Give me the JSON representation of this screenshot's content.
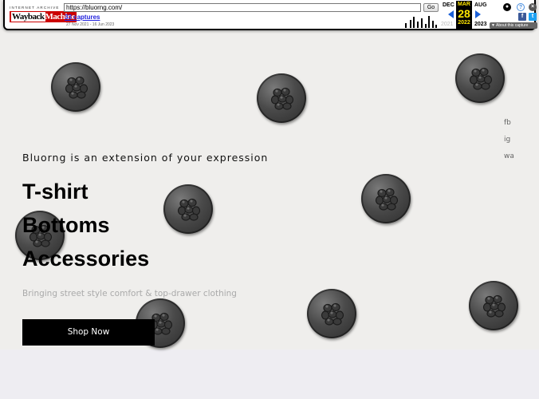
{
  "wayback": {
    "logo_top": "INTERNET ARCHIVE",
    "logo_main_a": "Wayback",
    "logo_main_b": "Machine",
    "url": "https://bluorng.com/",
    "go_label": "Go",
    "captures_label": "33 captures",
    "date_range": "27 Nov 2021 - 16 Jun 2023",
    "prev_month": "DEC",
    "current_month": "MAR",
    "current_day": "28",
    "current_year": "2022",
    "next_month": "AUG",
    "prev_year": "2021",
    "next_year": "2023",
    "about_label": "▼ About this capture",
    "help_glyph": "?",
    "close_glyph": "×",
    "fb_glyph": "f",
    "tw_glyph": "t",
    "colors": {
      "today_bg": "#000000",
      "today_fg": "#ffe600",
      "arrow": "#1a5fd8",
      "captures": "#2222dd"
    }
  },
  "hero": {
    "tagline": "Bluorng is an extension of your expression",
    "categories": [
      "T-shirt",
      "Bottoms",
      "Accessories"
    ],
    "subtitle": "Bringing street style comfort & top-drawer clothing",
    "cta_label": "Shop Now"
  },
  "social": [
    "fb",
    "ig",
    "wa"
  ]
}
